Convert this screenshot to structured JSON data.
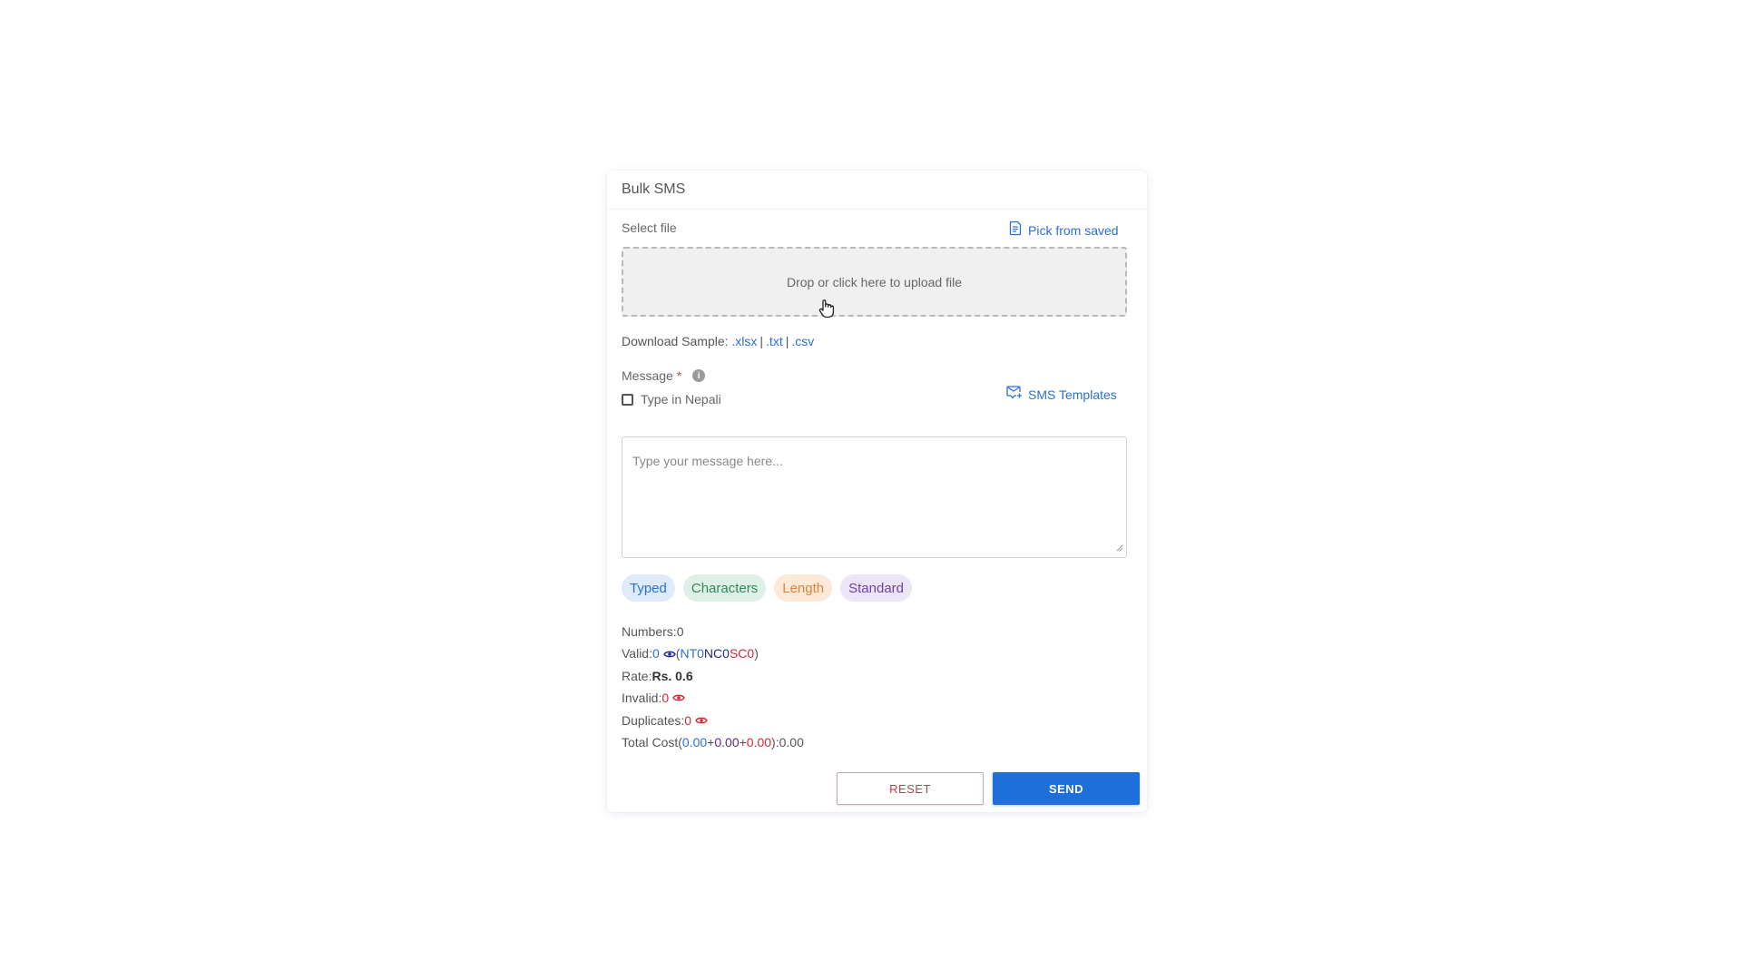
{
  "header": {
    "title": "Bulk SMS"
  },
  "file": {
    "label": "Select file",
    "pick_saved": "Pick from saved",
    "dropzone_text": "Drop or click here to upload file"
  },
  "sample": {
    "label": "Download Sample:",
    "links": [
      ".xlsx",
      ".txt",
      ".csv"
    ],
    "separator": "|"
  },
  "message": {
    "label": "Message",
    "required_mark": "*",
    "info_glyph": "i",
    "nepali_label": "Type in Nepali",
    "templates_link": "SMS Templates",
    "placeholder": "Type your message here..."
  },
  "chips": {
    "typed": "Typed",
    "characters": "Characters",
    "length": "Length",
    "standard": "Standard"
  },
  "stats": {
    "numbers_label": "Numbers:",
    "numbers_value": "0",
    "valid_label": "Valid:",
    "valid_value": "0",
    "open_paren": "(",
    "close_paren": ")",
    "nt_label": "NT",
    "nt_value": "0",
    "nc_label": "NC",
    "nc_value": "0",
    "sc_label": "SC",
    "sc_value": "0",
    "rate_label": "Rate:",
    "rate_value": "Rs. 0.6",
    "invalid_label": "Invalid:",
    "invalid_value": "0",
    "duplicates_label": "Duplicates:",
    "duplicates_value": "0",
    "total_label": "Total Cost",
    "cost_nt": "0.00",
    "cost_nc": "0.00",
    "cost_sc": "0.00",
    "plus": "+",
    "colon": ":",
    "total_value": "0.00"
  },
  "buttons": {
    "reset": "RESET",
    "send": "SEND"
  },
  "colors": {
    "accent": "#1f6fdb",
    "danger": "#d3283b",
    "link": "#2a6fd6"
  }
}
